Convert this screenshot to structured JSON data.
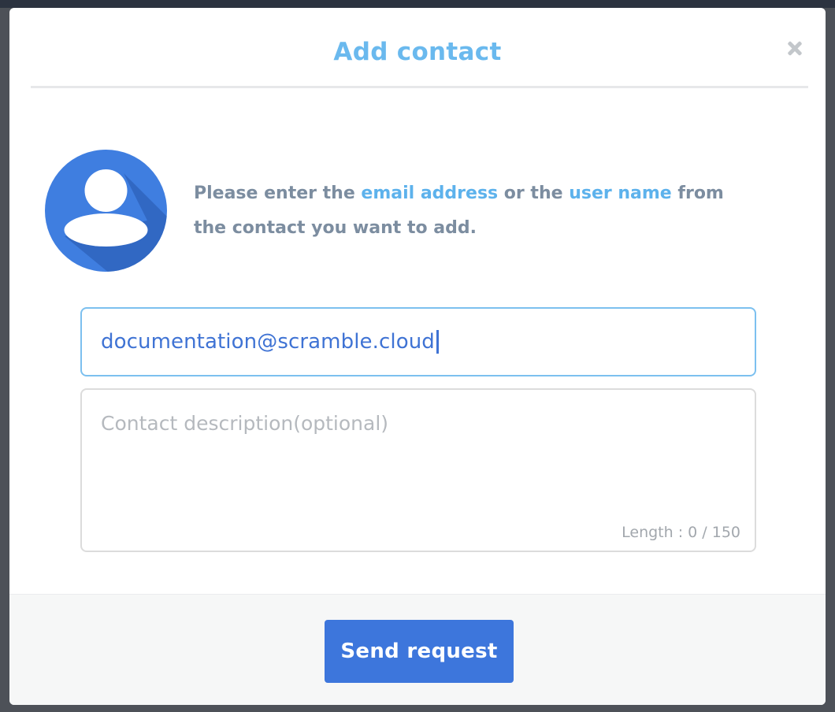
{
  "dialog": {
    "title": "Add contact",
    "close_icon": "close-icon",
    "avatar_icon": "user-avatar-icon",
    "instructions": {
      "part1": "Please enter the ",
      "highlight1": "email address",
      "part2": " or the ",
      "highlight2": "user name",
      "part3": " from the contact you want to add."
    },
    "email_input": {
      "value": "documentation@scramble.cloud"
    },
    "description": {
      "placeholder": "Contact description(optional)",
      "length_label": "Length : 0 / 150"
    },
    "send_button_label": "Send request"
  },
  "colors": {
    "accent": "#3d76dc",
    "title": "#6ab9ee",
    "highlight": "#5db2ec",
    "body_text": "#7c8da0"
  }
}
